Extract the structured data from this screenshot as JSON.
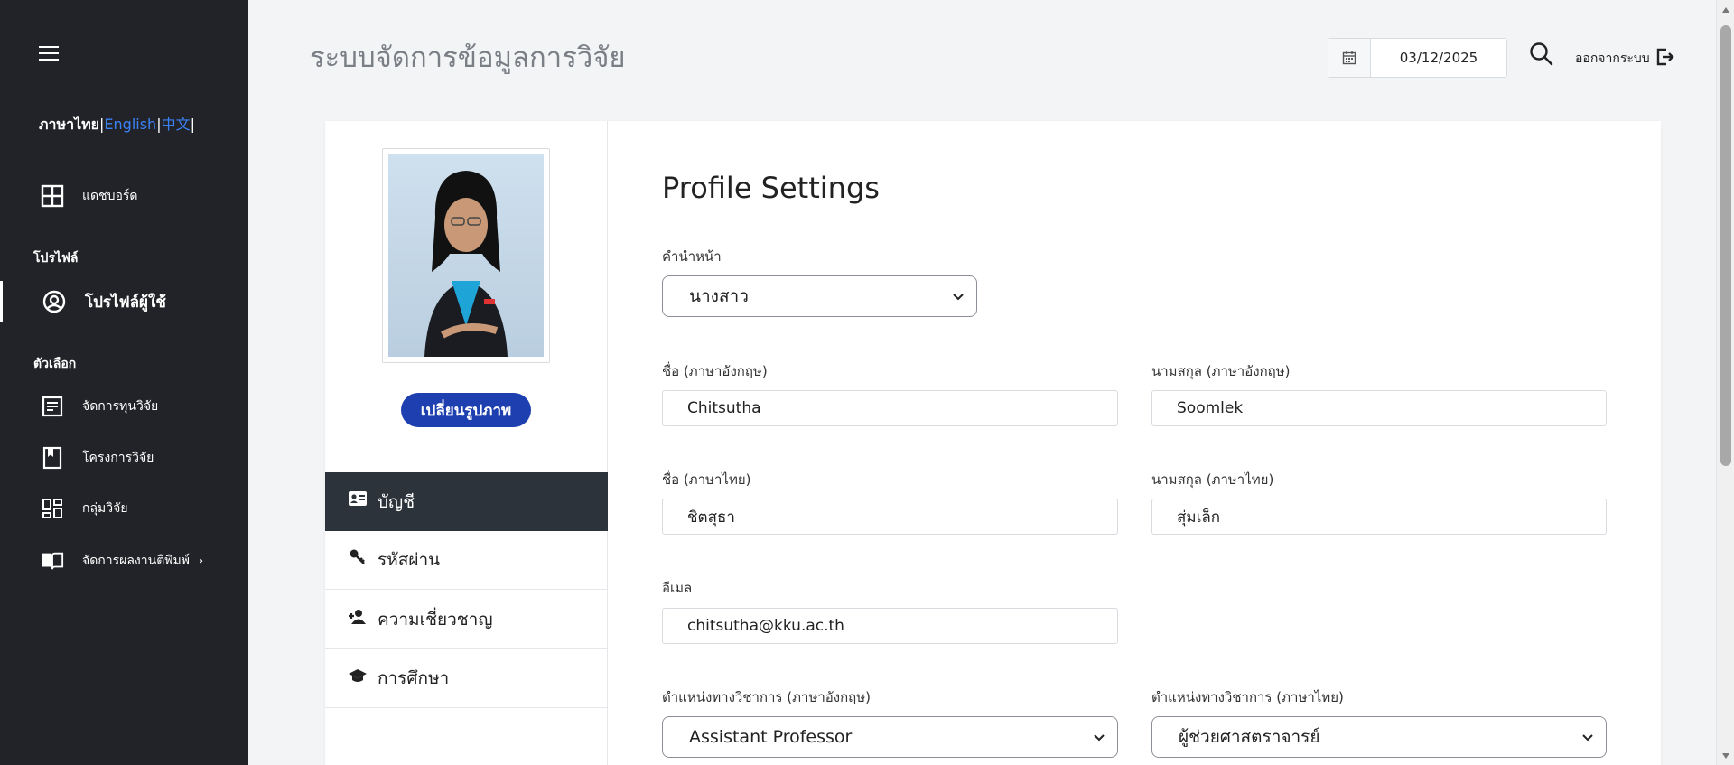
{
  "app": {
    "title": "ระบบจัดการข้อมูลการวิจัย",
    "date": "03/12/2025",
    "logout_label": "ออกจากระบบ"
  },
  "sidebar": {
    "lang": {
      "th": "ภาษาไทย",
      "en": "English",
      "cn": "中文",
      "sep": "|"
    },
    "dashboard_label": "แดชบอร์ด",
    "profile_section": "โปรไฟล์",
    "profile_label": "โปรไฟล์ผู้ใช้",
    "options_section": "ตัวเลือก",
    "items": [
      {
        "label": "จัดการทุนวิจัย",
        "icon": "document-icon"
      },
      {
        "label": "โครงการวิจัย",
        "icon": "bookmark-icon"
      },
      {
        "label": "กลุ่มวิจัย",
        "icon": "dashboard-grid-icon"
      },
      {
        "label": "จัดการผลงานตีพิมพ์",
        "icon": "book-open-icon"
      }
    ]
  },
  "profile_card": {
    "change_photo_label": "เปลี่ยนรูปภาพ",
    "tabs": [
      {
        "label": "บัญชี",
        "icon": "id-card-icon"
      },
      {
        "label": "รหัสผ่าน",
        "icon": "key-icon"
      },
      {
        "label": "ความเชี่ยวชาญ",
        "icon": "user-plus-icon"
      },
      {
        "label": "การศึกษา",
        "icon": "graduation-cap-icon"
      }
    ]
  },
  "form": {
    "title": "Profile Settings",
    "prefix_label": "คำนำหน้า",
    "prefix_value": "นางสาว",
    "first_name_en_label": "ชื่อ (ภาษาอังกฤษ)",
    "first_name_en_value": "Chitsutha",
    "last_name_en_label": "นามสกุล (ภาษาอังกฤษ)",
    "last_name_en_value": "Soomlek",
    "first_name_th_label": "ชื่อ (ภาษาไทย)",
    "first_name_th_value": "ชิตสุธา",
    "last_name_th_label": "นามสกุล (ภาษาไทย)",
    "last_name_th_value": "สุ่มเล็ก",
    "email_label": "อีเมล",
    "email_value": "chitsutha@kku.ac.th",
    "academic_en_label": "ตำแหน่งทางวิชาการ (ภาษาอังกฤษ)",
    "academic_en_value": "Assistant Professor",
    "academic_th_label": "ตำแหน่งทางวิชาการ (ภาษาไทย)",
    "academic_th_value": "ผู้ช่วยศาสตราจารย์"
  },
  "colors": {
    "sidebar_bg": "#212328",
    "accent_blue": "#1d3fb0",
    "active_tab_bg": "#2c333a"
  }
}
